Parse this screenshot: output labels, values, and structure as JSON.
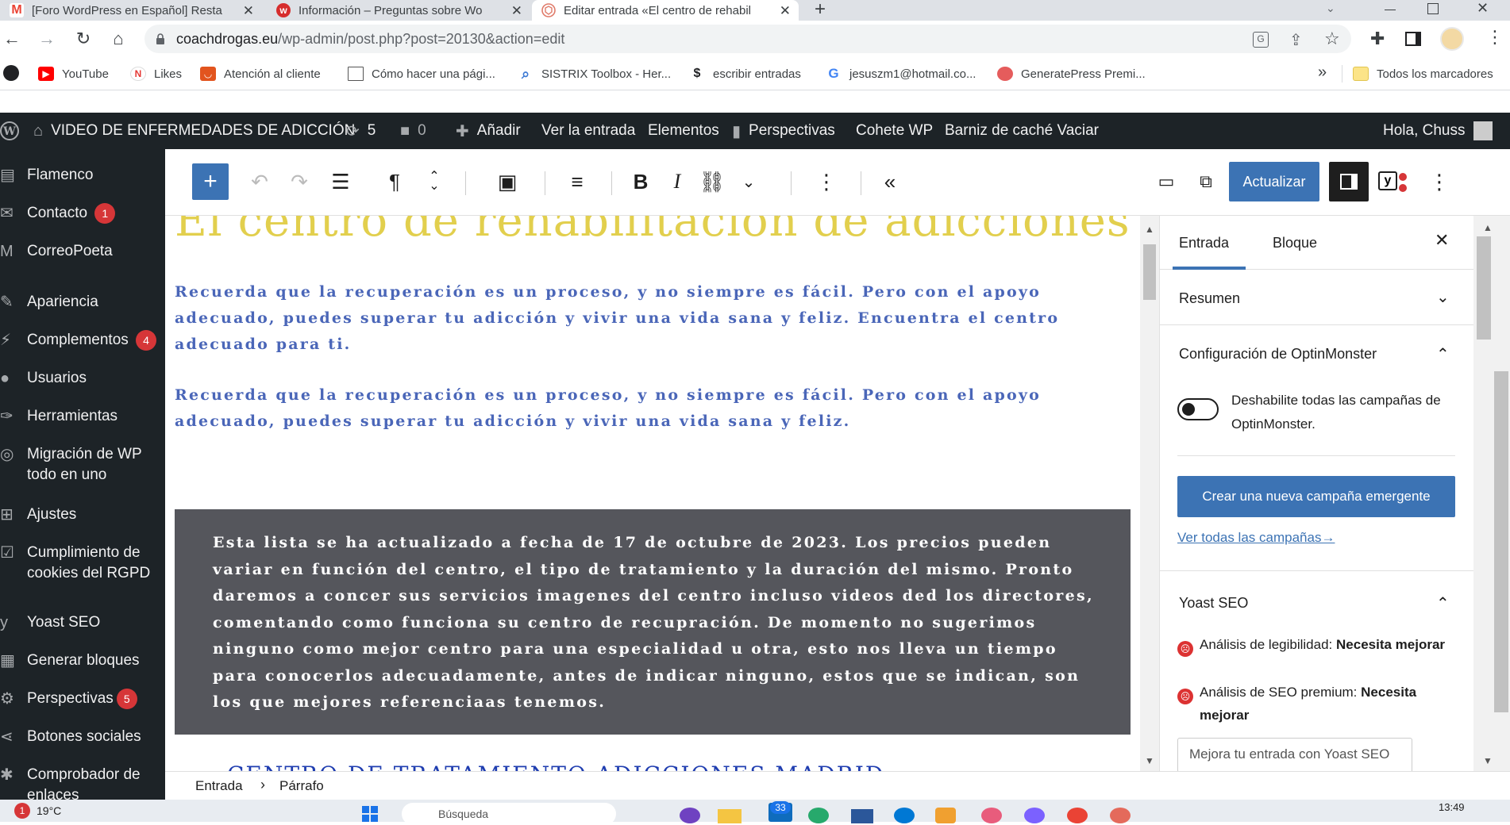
{
  "browser": {
    "tabs": [
      {
        "title": "[Foro WordPress en Español] Resta",
        "favicon": "gmail-icon",
        "active": false
      },
      {
        "title": "Información – Preguntas sobre Wo",
        "favicon": "webempresa-icon",
        "active": false
      },
      {
        "title": "Editar entrada «El centro de rehabil",
        "favicon": "wordpress-icon",
        "active": true
      }
    ],
    "new_tab": "+",
    "url_domain": "coachdrogas.eu",
    "url_path": "/wp-admin/post.php?post=20130&action=edit"
  },
  "bookmarks": {
    "items": [
      {
        "label": "YouTube",
        "icon": "youtube-icon"
      },
      {
        "label": "Likes",
        "icon": "likes-icon"
      },
      {
        "label": "Atención al cliente",
        "icon": "support-icon"
      },
      {
        "label": "Cómo hacer una pági...",
        "icon": "page-icon"
      },
      {
        "label": "SISTRIX Toolbox - Her...",
        "icon": "sistrix-icon"
      },
      {
        "label": "escribir entradas",
        "icon": "dollar-icon"
      },
      {
        "label": "jesuszm1@hotmail.co...",
        "icon": "google-icon"
      },
      {
        "label": "GeneratePress Premi...",
        "icon": "generatepress-icon"
      }
    ],
    "more": "»",
    "all_bookmarks": "Todos los marcadores"
  },
  "adminbar": {
    "site_name": "VIDEO DE ENFERMEDADES DE ADICCIÓN",
    "updates_count": "5",
    "comments_count": "0",
    "add_new": "Añadir",
    "view_post": "Ver la entrada",
    "elements": "Elementos",
    "insights": "Perspectivas",
    "rocket": "Cohete WP",
    "cache": "Barniz de caché Vaciar",
    "greeting": "Hola, Chuss"
  },
  "sidebar": {
    "items": [
      {
        "label": "Flamenco",
        "icon": "flamenco-icon",
        "badge": ""
      },
      {
        "label": "Contacto",
        "icon": "mail-icon",
        "badge": "1"
      },
      {
        "label": "CorreoPoeta",
        "icon": "poet-icon",
        "badge": ""
      },
      {
        "label": "Apariencia",
        "icon": "brush-icon",
        "badge": ""
      },
      {
        "label": "Complementos",
        "icon": "plugin-icon",
        "badge": "4"
      },
      {
        "label": "Usuarios",
        "icon": "users-icon",
        "badge": ""
      },
      {
        "label": "Herramientas",
        "icon": "wrench-icon",
        "badge": ""
      },
      {
        "label": "Migración de WP todo en uno",
        "icon": "migration-icon",
        "badge": ""
      },
      {
        "label": "Ajustes",
        "icon": "settings-icon",
        "badge": ""
      },
      {
        "label": "Cumplimiento de cookies del RGPD",
        "icon": "check-icon",
        "badge": ""
      },
      {
        "label": "Yoast SEO",
        "icon": "yoast-icon",
        "badge": ""
      },
      {
        "label": "Generar bloques",
        "icon": "blocks-icon",
        "badge": ""
      },
      {
        "label": "Perspectivas",
        "icon": "insights-icon",
        "badge": "5"
      },
      {
        "label": "Botones sociales",
        "icon": "share-icon",
        "badge": ""
      },
      {
        "label": "Comprobador de enlaces",
        "icon": "link-checker-icon",
        "badge": ""
      }
    ]
  },
  "editor": {
    "update_button": "Actualizar",
    "title": "El centro de rehabilitación de adicciones",
    "paragraph_1": "Recuerda que la recuperación es un proceso, y no siempre es fácil. Pero con el apoyo adecuado, puedes superar tu adicción y vivir una vida sana y feliz. Encuentra el centro adecuado para ti.",
    "paragraph_2": "Recuerda que la recuperación es un proceso, y no siempre es fácil. Pero con el apoyo adecuado, puedes superar tu adicción y vivir una vida sana y feliz.",
    "dark_box_text": "Esta lista se ha actualizado a fecha de 17 de octubre de 2023. Los precios pueden variar en función del centro, el tipo de tratamiento y la duración del mismo. Pronto daremos a concer sus servicios imagenes del centro incluso videos ded los directores, comentando como funciona su centro de recupración. De momento no sugerimos ninguno como mejor centro para una especialidad u otra, esto nos lleva un tiempo para conocerlos adecuadamente, antes de indicar ninguno, estos que se indican, son los que mejores referenciaas tenemos.",
    "subheading": "CENTRO DE TRATAMIENTO ADICCIONES MADRID"
  },
  "settings": {
    "tab_post": "Entrada",
    "tab_block": "Bloque",
    "summary": "Resumen",
    "optinmonster_title": "Configuración de OptinMonster",
    "toggle_label": "Deshabilite todas las campañas de OptinMonster.",
    "create_campaign": "Crear una nueva campaña emergente",
    "view_campaigns": "Ver todas las campañas→",
    "yoast_title": "Yoast SEO",
    "readability_label": "Análisis de legibilidad:",
    "readability_value": "Necesita mejorar",
    "seo_label": "Análisis de SEO premium:",
    "seo_value": "Necesita mejorar",
    "yoast_button": "Mejora tu entrada con Yoast SEO"
  },
  "breadcrumb": {
    "root": "Entrada",
    "separator": "›",
    "current": "Párrafo"
  },
  "taskbar": {
    "weather_badge": "1",
    "temperature": "19°C",
    "search_placeholder": "Búsqueda",
    "mail_badge": "33",
    "clock": "13:49"
  },
  "colors": {
    "title": "#e2cf4d",
    "paragraph": "#4a66b8",
    "dark_box": "#55565c",
    "wp_blue": "#3c73b4",
    "admin_dark": "#1d2327",
    "badge_red": "#d63638"
  }
}
